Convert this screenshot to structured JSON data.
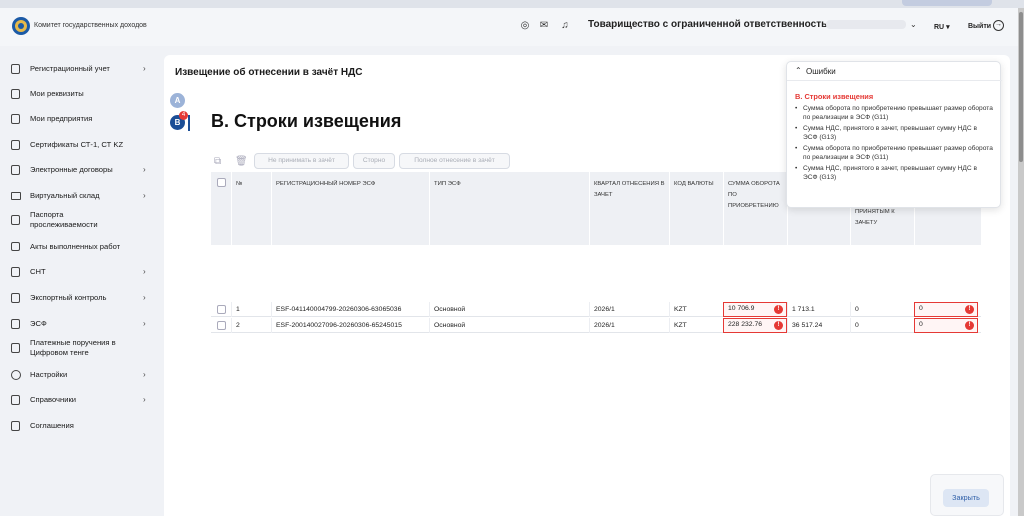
{
  "header": {
    "org_name": "Комитет государственных доходов",
    "company": "Товарищество с ограниченной ответственностью",
    "lang": "RU",
    "logout": "Выйти"
  },
  "sidebar": {
    "items": [
      {
        "label": "Регистрационный учет",
        "icon": "document-icon",
        "chevron": true
      },
      {
        "label": "Мои реквизиты",
        "icon": "document-icon",
        "chevron": false
      },
      {
        "label": "Мои предприятия",
        "icon": "document-icon",
        "chevron": false
      },
      {
        "label": "Сертификаты СТ-1, СТ KZ",
        "icon": "document-icon",
        "chevron": false
      },
      {
        "label": "Электронные договоры",
        "icon": "contract-icon",
        "chevron": true
      },
      {
        "label": "Виртуальный склад",
        "icon": "folder-icon",
        "chevron": true
      },
      {
        "label": "Паспорта прослеживаемости",
        "icon": "document-icon",
        "chevron": false
      },
      {
        "label": "Акты выполненных работ",
        "icon": "checkbox-icon",
        "chevron": false
      },
      {
        "label": "СНТ",
        "icon": "truck-icon",
        "chevron": true
      },
      {
        "label": "Экспортный контроль",
        "icon": "document-icon",
        "chevron": true
      },
      {
        "label": "ЭСФ",
        "icon": "document-icon",
        "chevron": true
      },
      {
        "label": "Платежные поручения в Цифровом тенге",
        "icon": "document-icon",
        "chevron": false
      },
      {
        "label": "Настройки",
        "icon": "gear-icon",
        "chevron": true
      },
      {
        "label": "Справочники",
        "icon": "book-icon",
        "chevron": true
      },
      {
        "label": "Соглашения",
        "icon": "document-icon",
        "chevron": false
      }
    ]
  },
  "main": {
    "title": "Извещение об отнесении в зачёт НДС",
    "step_a": "A",
    "step_b": "B",
    "step_b_badge": "4",
    "section_title": "B. Строки извещения",
    "toolbar": {
      "reject": "Не принимать в зачёт",
      "storno": "Сторно",
      "full": "Полное отнесение в зачёт"
    },
    "table": {
      "headers": {
        "num": "№",
        "reg": "Регистрационный номер ЭСФ",
        "type": "Тип ЭСФ",
        "quarter": "Квартал отнесения в зачет",
        "currency": "Код валюты",
        "turnover": "Сумма оборота по приобретению",
        "vat": "зачет",
        "notaccepted": "НДС, не принятым к зачету",
        "tozachet": "к зачету"
      },
      "rows": [
        {
          "num": "1",
          "reg": "ESF-041140004799-20260306-63065036",
          "type": "Основной",
          "quarter": "2026/1",
          "currency": "KZT",
          "turnover": "10 706.9",
          "vat": "1 713.1",
          "notaccepted": "0",
          "tozachet": "0"
        },
        {
          "num": "2",
          "reg": "ESF-200140027096-20260306-65245015",
          "type": "Основной",
          "quarter": "2026/1",
          "currency": "KZT",
          "turnover": "228 232.76",
          "vat": "36 517.24",
          "notaccepted": "0",
          "tozachet": "0"
        }
      ]
    }
  },
  "errors": {
    "title": "Ошибки",
    "section": "B. Строки извещения",
    "items": [
      "Сумма оборота по приобретению превышает размер оборота по реализации в ЭСФ (G11)",
      "Сумма НДС, принятого в зачет, превышает сумму НДС в ЭСФ (G13)",
      "Сумма оборота по приобретению превышает размер оборота по реализации в ЭСФ (G11)",
      "Сумма НДС, принятого в зачет, превышает сумму НДС в ЭСФ (G13)"
    ]
  },
  "footer": {
    "close": "Закрыть"
  },
  "colors": {
    "accent": "#1c4e96",
    "error": "#e53935"
  }
}
